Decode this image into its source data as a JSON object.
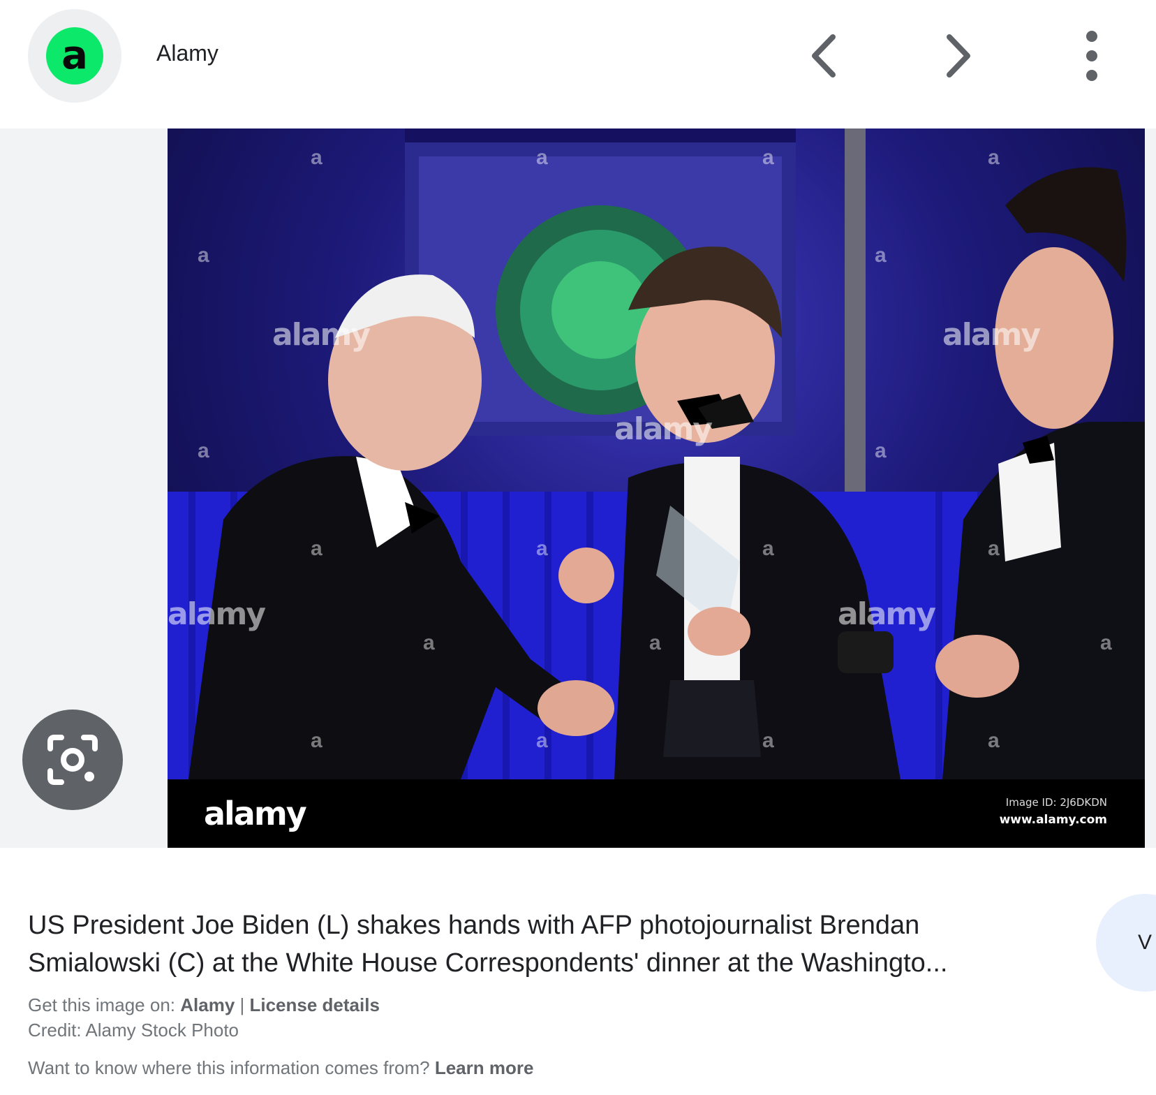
{
  "header": {
    "logo_letter": "a",
    "site_name": "Alamy"
  },
  "photo": {
    "watermark": "alamy",
    "watermark_small": "a",
    "footer_logo": "alamy",
    "image_id": "Image ID: 2J6DKDN",
    "url": "www.alamy.com"
  },
  "caption": {
    "title_line1": "US President Joe Biden (L) shakes hands with AFP photojournalist Brendan",
    "title_line2": "Smialowski (C) at the White House Correspondents' dinner at the Washingto...",
    "visit_label": "V"
  },
  "meta": {
    "get_image_prefix": "Get this image on: ",
    "get_image_source": "Alamy",
    "separator": " | ",
    "license_link": "License details",
    "credit": "Credit: Alamy Stock Photo",
    "info_question": "Want to know where this information comes from? ",
    "learn_more": "Learn more"
  },
  "colors": {
    "logo_green": "#0be86a",
    "lens_button": "#5f6368",
    "visit_button": "#e8f0fe"
  }
}
